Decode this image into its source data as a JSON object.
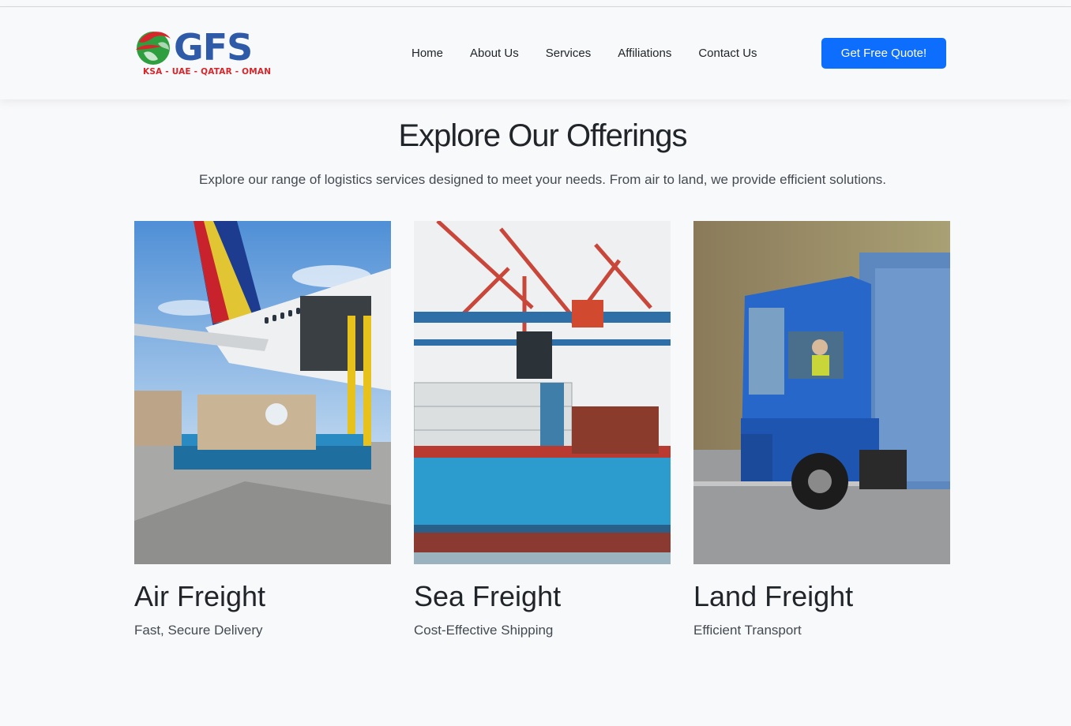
{
  "brand": {
    "logo_text": "GFS",
    "logo_sub": "KSA - UAE - QATAR - OMAN",
    "colors": {
      "blue": "#2e5aa8",
      "red": "#d7262b",
      "green": "#2e9e3f"
    }
  },
  "nav": {
    "items": [
      {
        "label": "Home"
      },
      {
        "label": "About Us"
      },
      {
        "label": "Services"
      },
      {
        "label": "Affiliations"
      },
      {
        "label": "Contact Us"
      }
    ],
    "cta_label": "Get Free Quote!"
  },
  "section": {
    "title": "Explore Our Offerings",
    "subtitle": "Explore our range of logistics services designed to meet your needs. From air to land, we provide efficient solutions."
  },
  "cards": [
    {
      "title": "Air Freight",
      "description": "Fast, Secure Delivery"
    },
    {
      "title": "Sea Freight",
      "description": "Cost-Effective Shipping"
    },
    {
      "title": "Land Freight",
      "description": "Efficient Transport"
    }
  ],
  "colors": {
    "accent": "#0d6efd",
    "background": "#f8f9fb",
    "text": "#212529"
  }
}
